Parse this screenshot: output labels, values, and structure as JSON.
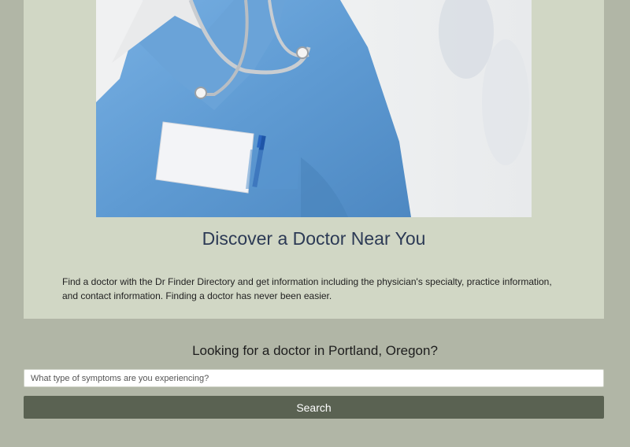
{
  "hero": {
    "image_alt": "Doctor in blue scrubs with stethoscope",
    "title": "Discover a Doctor Near You",
    "description": "Find a doctor with the Dr Finder Directory and get information including the physician's specialty, practice information, and contact information. Finding a doctor has never been easier."
  },
  "search": {
    "heading": "Looking for a doctor in Portland, Oregon?",
    "placeholder": "What type of symptoms are you experiencing?",
    "button_label": "Search"
  },
  "colors": {
    "page_background": "#b1b6a6",
    "card_background": "#d1d7c5",
    "title_color": "#2c3a55",
    "button_background": "#5a6252",
    "scrubs_blue": "#6aa3d8"
  }
}
